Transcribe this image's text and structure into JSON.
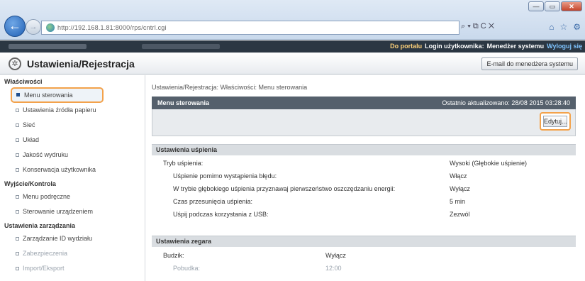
{
  "browser": {
    "url": "http://192.168.1.81:8000/rps/cntrl.cgi",
    "search_tools": "⌕ ▾ ⧉ C ✕",
    "win_min": "—",
    "win_max": "▭",
    "win_close": "✕"
  },
  "site_bar": {
    "portal": "Do portalu",
    "login_label": "Login użytkownika:",
    "user": "Menedżer systemu",
    "logout": "Wyloguj się"
  },
  "header": {
    "title": "Ustawienia/Rejestracja",
    "email_button": "E-mail do menedżera systemu"
  },
  "sidebar": {
    "sections": [
      {
        "title": "Właściwości",
        "items": [
          {
            "label": "Menu sterowania",
            "active": true
          },
          {
            "label": "Ustawienia źródła papieru"
          },
          {
            "label": "Sieć"
          },
          {
            "label": "Układ"
          },
          {
            "label": "Jakość wydruku"
          },
          {
            "label": "Konserwacja użytkownika"
          }
        ]
      },
      {
        "title": "Wyjście/Kontrola",
        "items": [
          {
            "label": "Menu podręczne"
          },
          {
            "label": "Sterowanie urządzeniem"
          }
        ]
      },
      {
        "title": "Ustawienia zarządzania",
        "items": [
          {
            "label": "Zarządzanie ID wydziału"
          },
          {
            "label": "Zabezpieczenia"
          },
          {
            "label": "Import/Eksport"
          }
        ]
      }
    ]
  },
  "main": {
    "breadcrumb": "Ustawienia/Rejestracja: Właściwości: Menu sterowania",
    "panel_title": "Menu sterowania",
    "last_updated": "Ostatnio aktualizowano: 28/08 2015 03:28:40",
    "edit_button": "Edytuj...",
    "sleep_section": "Ustawienia uśpienia",
    "sleep_rows": [
      {
        "label": "Tryb uśpienia:",
        "value": "Wysoki (Głębokie uśpienie)",
        "sub": false
      },
      {
        "label": "Uśpienie pomimo wystąpienia błędu:",
        "value": "Włącz",
        "sub": true
      },
      {
        "label": "W trybie głębokiego uśpienia przyznawaj pierwszeństwo oszczędzaniu energii:",
        "value": "Wyłącz",
        "sub": true
      },
      {
        "label": "Czas przesunięcia uśpienia:",
        "value": "5 min",
        "sub": true
      },
      {
        "label": "Uśpij podczas korzystania z USB:",
        "value": "Zezwól",
        "sub": true
      }
    ],
    "clock_section": "Ustawienia zegara",
    "clock_rows": [
      {
        "label": "Budzik:",
        "value": "Wyłącz"
      },
      {
        "label": "Pobudka:",
        "value": "12:00"
      }
    ]
  }
}
